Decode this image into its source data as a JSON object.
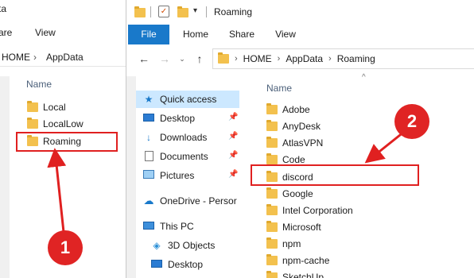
{
  "back_window": {
    "title_fragment": "ta",
    "ribbon": {
      "share": "are",
      "view": "View"
    },
    "address": {
      "part1": "HOME",
      "part2": "AppData"
    },
    "column_header": "Name",
    "items": [
      {
        "label": "Local"
      },
      {
        "label": "LocalLow"
      },
      {
        "label": "Roaming"
      }
    ]
  },
  "front_window": {
    "title": "Roaming",
    "tabs": {
      "file": "File",
      "home": "Home",
      "share": "Share",
      "view": "View"
    },
    "breadcrumb": [
      "HOME",
      "AppData",
      "Roaming"
    ],
    "nav": {
      "quick_access": "Quick access",
      "desktop": "Desktop",
      "downloads": "Downloads",
      "documents": "Documents",
      "pictures": "Pictures",
      "onedrive": "OneDrive - Persor",
      "this_pc": "This PC",
      "objects3d": "3D Objects",
      "desktop2": "Desktop"
    },
    "column_header": "Name",
    "folders": [
      {
        "label": "Adobe"
      },
      {
        "label": "AnyDesk"
      },
      {
        "label": "AtlasVPN"
      },
      {
        "label": "Code"
      },
      {
        "label": "discord"
      },
      {
        "label": "Google"
      },
      {
        "label": "Intel Corporation"
      },
      {
        "label": "Microsoft"
      },
      {
        "label": "npm"
      },
      {
        "label": "npm-cache"
      },
      {
        "label": "SketchUp"
      }
    ]
  },
  "annotations": {
    "step1": "1",
    "step2": "2",
    "color": "#e02020"
  },
  "icons": [
    "folder-icon",
    "pin-icon",
    "star-icon",
    "desktop-icon",
    "download-icon",
    "documents-icon",
    "pictures-icon",
    "cloud-icon",
    "pc-icon",
    "cube-icon"
  ]
}
